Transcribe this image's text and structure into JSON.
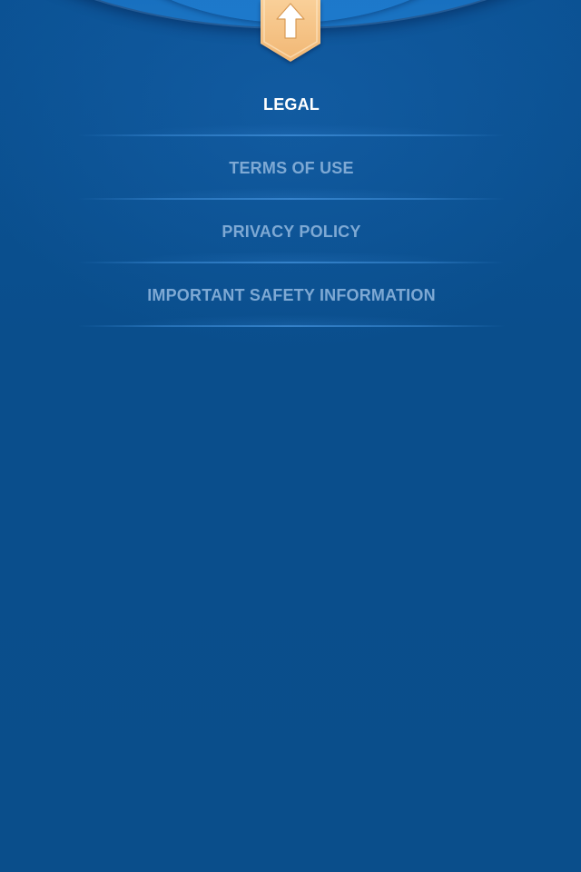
{
  "header": {
    "title": "LEGAL"
  },
  "menu": {
    "items": [
      {
        "label": "TERMS OF USE"
      },
      {
        "label": "PRIVACY POLICY"
      },
      {
        "label": "IMPORTANT SAFETY INFORMATION"
      }
    ]
  },
  "icons": {
    "bookmark": "up-arrow-icon"
  },
  "colors": {
    "background": "#0a4f8e",
    "header_text": "#ffffff",
    "menu_text": "#7ea9d4",
    "bookmark": "#f7c48a"
  }
}
